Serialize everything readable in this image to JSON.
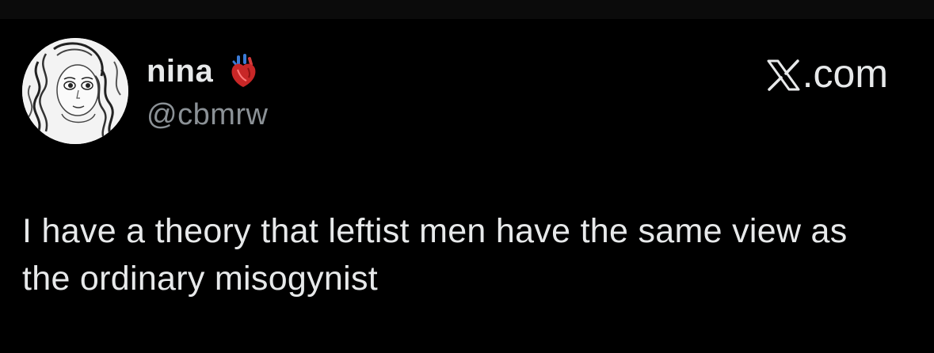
{
  "author": {
    "display_name": "nina",
    "handle": "@cbmrw",
    "name_emoji": "anatomical-heart-emoji"
  },
  "site": {
    "label": ".com",
    "logo_icon": "x-logo-icon"
  },
  "tweet": {
    "text": "I have a theory that leftist men have the same view as the ordinary misogynist"
  },
  "colors": {
    "background": "#000000",
    "text_primary": "#e7e9ea",
    "text_secondary": "#8b9196"
  }
}
